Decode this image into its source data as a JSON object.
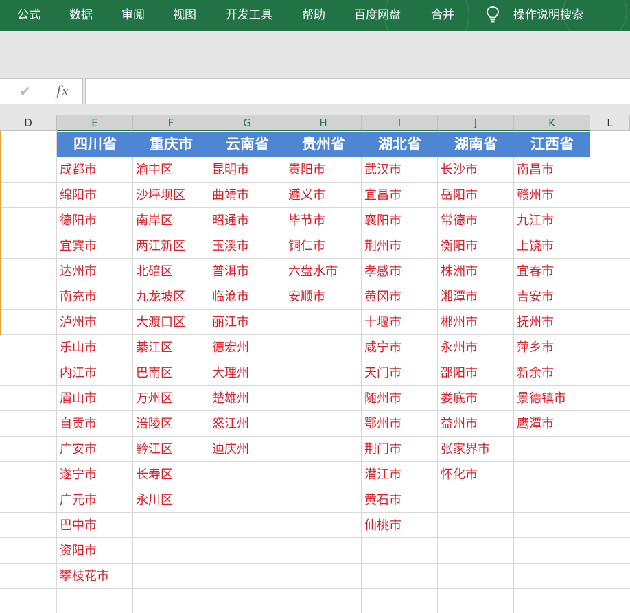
{
  "ribbon": {
    "tabs": [
      "公式",
      "数据",
      "审阅",
      "视图",
      "开发工具",
      "帮助",
      "百度网盘",
      "合并"
    ],
    "search_label": "操作说明搜索"
  },
  "formula_bar": {
    "confirm_glyph": "✔",
    "fx_label": "fx",
    "value": ""
  },
  "columns": [
    "D",
    "E",
    "F",
    "G",
    "H",
    "I",
    "J",
    "K",
    "L"
  ],
  "headers": [
    "四川省",
    "重庆市",
    "云南省",
    "贵州省",
    "湖北省",
    "湖南省",
    "江西省"
  ],
  "cities": [
    [
      "成都市",
      "绵阳市",
      "德阳市",
      "宜宾市",
      "达州市",
      "南充市",
      "泸州市",
      "乐山市",
      "内江市",
      "眉山市",
      "自贡市",
      "广安市",
      "遂宁市",
      "广元市",
      "巴中市",
      "资阳市",
      "攀枝花市"
    ],
    [
      "渝中区",
      "沙坪坝区",
      "南岸区",
      "两江新区",
      "北碚区",
      "九龙坡区",
      "大渡口区",
      "綦江区",
      "巴南区",
      "万州区",
      "涪陵区",
      "黔江区",
      "长寿区",
      "永川区"
    ],
    [
      "昆明市",
      "曲靖市",
      "昭通市",
      "玉溪市",
      "普洱市",
      "临沧市",
      "丽江市",
      "德宏州",
      "大理州",
      "楚雄州",
      "怒江州",
      "迪庆州"
    ],
    [
      "贵阳市",
      "遵义市",
      "毕节市",
      "铜仁市",
      "六盘水市",
      "安顺市"
    ],
    [
      "武汉市",
      "宜昌市",
      "襄阳市",
      "荆州市",
      "孝感市",
      "黄冈市",
      "十堰市",
      "咸宁市",
      "天门市",
      "随州市",
      "鄂州市",
      "荆门市",
      "潜江市",
      "黄石市",
      "仙桃市"
    ],
    [
      "长沙市",
      "岳阳市",
      "常德市",
      "衡阳市",
      "株洲市",
      "湘潭市",
      "郴州市",
      "永州市",
      "邵阳市",
      "娄底市",
      "益州市",
      "张家界市",
      "怀化市"
    ],
    [
      "南昌市",
      "赣州市",
      "九江市",
      "上饶市",
      "宜春市",
      "吉安市",
      "抚州市",
      "萍乡市",
      "新余市",
      "景德镇市",
      "鹰潭市"
    ]
  ],
  "colors": {
    "ribbon": "#217346",
    "header_fill": "#4f86d4",
    "city_text": "#d9202a"
  }
}
